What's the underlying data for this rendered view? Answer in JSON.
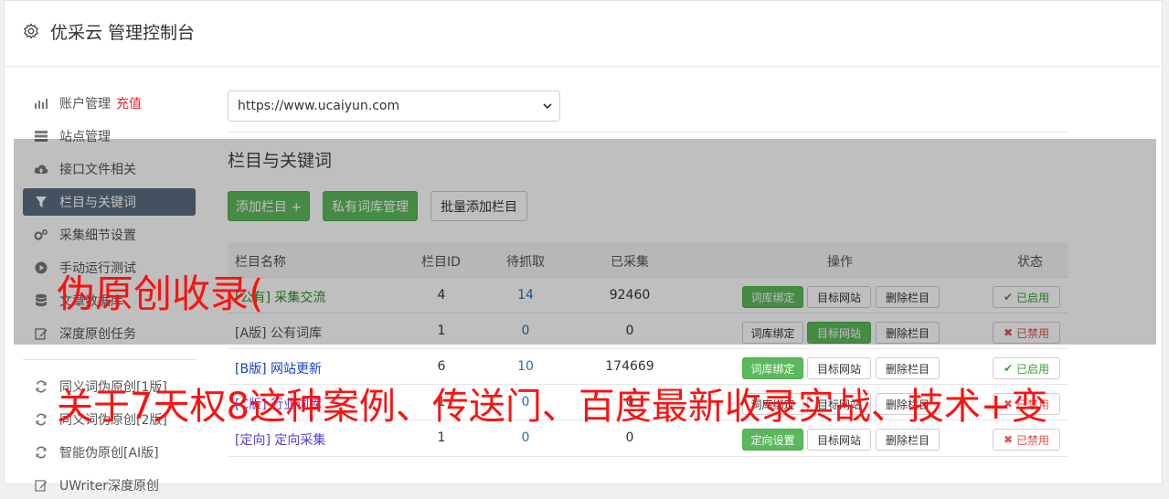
{
  "header": {
    "title": "优采云 管理控制台"
  },
  "sidebar": {
    "items": [
      {
        "label": "账户管理",
        "highlight": "充值",
        "icon": "bar-chart-icon"
      },
      {
        "label": "站点管理",
        "icon": "server-icon"
      },
      {
        "label": "接口文件相关",
        "icon": "cloud-upload-icon"
      },
      {
        "label": "栏目与关键词",
        "icon": "filter-icon",
        "active": true
      },
      {
        "label": "采集细节设置",
        "icon": "gears-icon"
      },
      {
        "label": "手动运行测试",
        "icon": "play-circle-icon"
      },
      {
        "label": "文章数据库",
        "icon": "database-icon"
      },
      {
        "label": "深度原创任务",
        "icon": "edit-icon"
      },
      {
        "label": "同义词伪原创[1版]",
        "icon": "refresh-icon"
      },
      {
        "label": "同义词伪原创[2版]",
        "icon": "refresh-icon"
      },
      {
        "label": "智能伪原创[AI版]",
        "icon": "refresh-icon"
      },
      {
        "label": "UWriter深度原创",
        "icon": "edit-icon"
      }
    ]
  },
  "site_select": {
    "value": "https://www.ucaiyun.com"
  },
  "section_title": "栏目与关键词",
  "toolbar": {
    "add_column": "添加栏目 +",
    "private_lexicon": "私有词库管理",
    "batch_add": "批量添加栏目"
  },
  "table": {
    "headers": [
      "栏目名称",
      "栏目ID",
      "待抓取",
      "已采集",
      "操作",
      "状态"
    ],
    "rows": [
      {
        "tag": "[公有]",
        "name": "采集交流",
        "id": "4",
        "pending": "14",
        "collected": "92460",
        "actions": [
          "词库绑定",
          "目标网站",
          "删除栏目"
        ],
        "status": "已启用"
      },
      {
        "tag": "[A版]",
        "name": "公有词库",
        "id": "1",
        "pending": "0",
        "collected": "0",
        "actions": [
          "词库绑定",
          "目标网站",
          "删除栏目"
        ],
        "status": "已禁用"
      },
      {
        "tag": "[B版]",
        "name": "网站更新",
        "id": "6",
        "pending": "10",
        "collected": "174669",
        "actions": [
          "词库绑定",
          "目标网站",
          "删除栏目"
        ],
        "status": "已启用"
      },
      {
        "tag": "[C版]",
        "name": "行业词库",
        "id": "1",
        "pending": "0",
        "collected": "0",
        "actions": [
          "词库绑定",
          "目标网站",
          "删除栏目"
        ],
        "status": "已禁用"
      },
      {
        "tag": "[定向]",
        "name": "定向采集",
        "id": "1",
        "pending": "0",
        "collected": "0",
        "actions": [
          "定向设置",
          "目标网站",
          "删除栏目"
        ],
        "status": "已禁用"
      }
    ]
  },
  "promo": {
    "line1": "伪原创收录(",
    "line2": "关于7天权8这种案例、传送门、百度最新收录实战、技术+变"
  },
  "colors": {
    "accent_green": "#5cb85c",
    "active_sidebar": "#5a6d80",
    "promo_red": "#ff1010"
  }
}
